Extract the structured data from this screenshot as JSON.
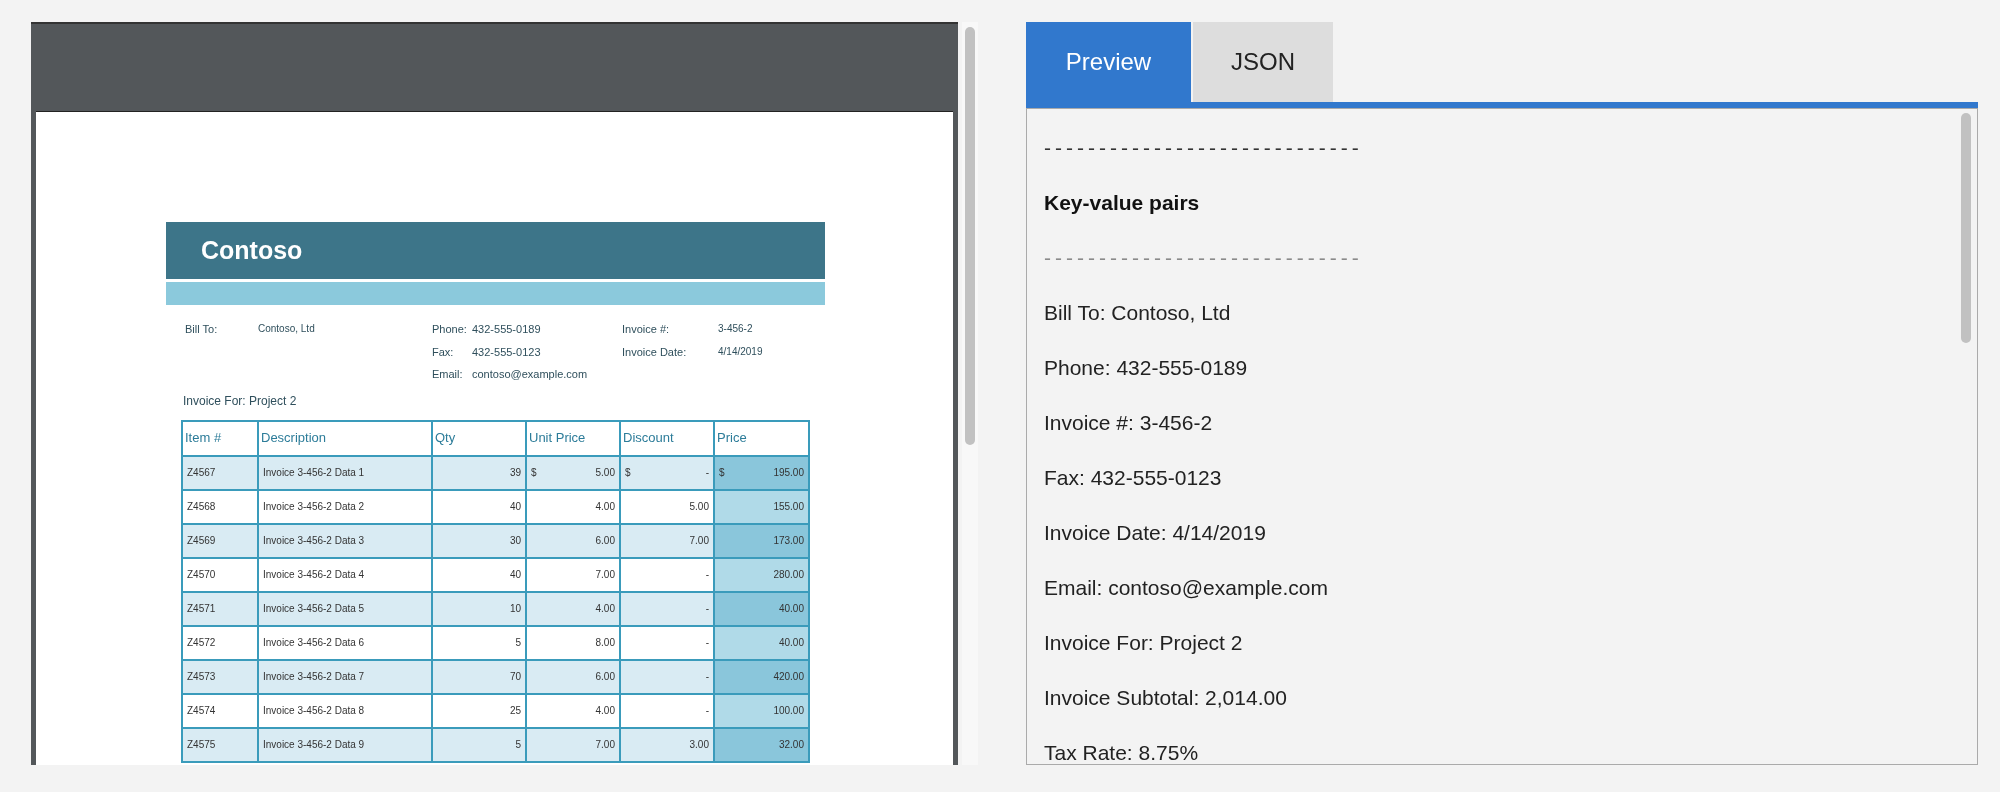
{
  "document": {
    "company": "Contoso",
    "bill_to": {
      "label": "Bill To:",
      "value": "Contoso, Ltd"
    },
    "contact": [
      {
        "label": "Phone:",
        "value": "432-555-0189"
      },
      {
        "label": "Fax:",
        "value": "432-555-0123"
      },
      {
        "label": "Email:",
        "value": "contoso@example.com"
      }
    ],
    "invoice_fields": [
      {
        "label": "Invoice #:",
        "value": "3-456-2"
      },
      {
        "label": "Invoice Date:",
        "value": "4/14/2019"
      }
    ],
    "invoice_for": "Invoice For: Project 2",
    "table": {
      "columns": [
        "Item #",
        "Description",
        "Qty",
        "Unit Price",
        "Discount",
        "Price"
      ],
      "rows": [
        {
          "item": "Z4567",
          "description": "Invoice 3-456-2 Data 1",
          "qty": "39",
          "unit_price": {
            "currency": "$",
            "value": "5.00"
          },
          "discount": {
            "currency": "$",
            "value": "-"
          },
          "price": {
            "currency": "$",
            "value": "195.00"
          }
        },
        {
          "item": "Z4568",
          "description": "Invoice 3-456-2 Data 2",
          "qty": "40",
          "unit_price": {
            "value": "4.00"
          },
          "discount": {
            "value": "5.00"
          },
          "price": {
            "value": "155.00"
          }
        },
        {
          "item": "Z4569",
          "description": "Invoice 3-456-2 Data 3",
          "qty": "30",
          "unit_price": {
            "value": "6.00"
          },
          "discount": {
            "value": "7.00"
          },
          "price": {
            "value": "173.00"
          }
        },
        {
          "item": "Z4570",
          "description": "Invoice 3-456-2 Data 4",
          "qty": "40",
          "unit_price": {
            "value": "7.00"
          },
          "discount": {
            "value": "-"
          },
          "price": {
            "value": "280.00"
          }
        },
        {
          "item": "Z4571",
          "description": "Invoice 3-456-2 Data 5",
          "qty": "10",
          "unit_price": {
            "value": "4.00"
          },
          "discount": {
            "value": "-"
          },
          "price": {
            "value": "40.00"
          }
        },
        {
          "item": "Z4572",
          "description": "Invoice 3-456-2 Data 6",
          "qty": "5",
          "unit_price": {
            "value": "8.00"
          },
          "discount": {
            "value": "-"
          },
          "price": {
            "value": "40.00"
          }
        },
        {
          "item": "Z4573",
          "description": "Invoice 3-456-2 Data 7",
          "qty": "70",
          "unit_price": {
            "value": "6.00"
          },
          "discount": {
            "value": "-"
          },
          "price": {
            "value": "420.00"
          }
        },
        {
          "item": "Z4574",
          "description": "Invoice 3-456-2 Data 8",
          "qty": "25",
          "unit_price": {
            "value": "4.00"
          },
          "discount": {
            "value": "-"
          },
          "price": {
            "value": "100.00"
          }
        },
        {
          "item": "Z4575",
          "description": "Invoice 3-456-2 Data 9",
          "qty": "5",
          "unit_price": {
            "value": "7.00"
          },
          "discount": {
            "value": "3.00"
          },
          "price": {
            "value": "32.00"
          }
        }
      ]
    }
  },
  "tabs": [
    {
      "label": "Preview",
      "selected": true
    },
    {
      "label": "JSON",
      "selected": false
    }
  ],
  "preview_lines": [
    {
      "kind": "rule",
      "text": "-----------------------------",
      "muted": false
    },
    {
      "kind": "heading",
      "text": "Key-value pairs"
    },
    {
      "kind": "rule",
      "text": "-----------------------------",
      "muted": true
    },
    {
      "kind": "text",
      "text": "Bill To: Contoso, Ltd"
    },
    {
      "kind": "text",
      "text": "Phone: 432-555-0189"
    },
    {
      "kind": "text",
      "text": "Invoice #: 3-456-2"
    },
    {
      "kind": "text",
      "text": "Fax: 432-555-0123"
    },
    {
      "kind": "text",
      "text": "Invoice Date: 4/14/2019"
    },
    {
      "kind": "text",
      "text": "Email: contoso@example.com"
    },
    {
      "kind": "text",
      "text": "Invoice For: Project 2"
    },
    {
      "kind": "text",
      "text": "Invoice Subtotal: 2,014.00"
    },
    {
      "kind": "text",
      "text": "Tax Rate: 8.75%"
    }
  ]
}
